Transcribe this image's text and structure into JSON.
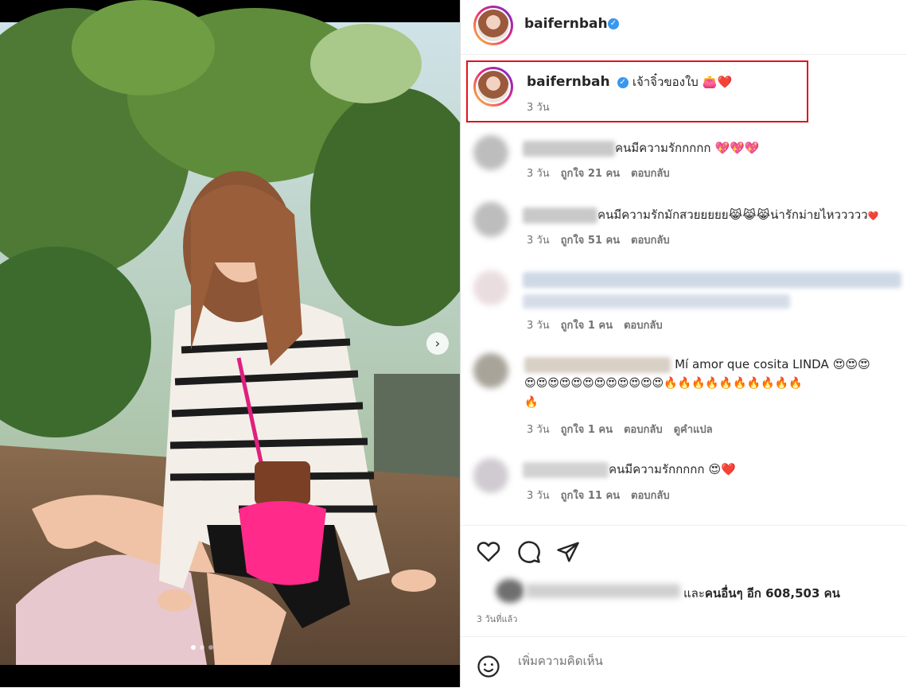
{
  "post": {
    "username": "baifernbah",
    "caption": {
      "text": "เจ้าจิ๋วของใบ",
      "emoji": "👛❤️",
      "time": "3 วัน"
    },
    "carousel": {
      "count": 3,
      "active": 1
    }
  },
  "comments": [
    {
      "text": "คนมีความรักกกกก",
      "emoji": "💖💖💖",
      "time": "3 วัน",
      "likes": "ถูกใจ 21 คน",
      "reply": "ตอบกลับ"
    },
    {
      "text": "คนมีความรักมักสวยยยยย",
      "emoji": "😹😹😹",
      "text2": "น่ารักม่ายไหววววว",
      "emoji2": "❤️",
      "time": "3 วัน",
      "likes": "ถูกใจ 51 คน",
      "reply": "ตอบกลับ"
    },
    {
      "text": "",
      "time": "3 วัน",
      "likes": "ถูกใจ 1 คน",
      "reply": "ตอบกลับ"
    },
    {
      "text": "Mí amor que cosita LINDA",
      "emoji": "😍😍😍",
      "emoji_line2": "😍😍😍😍😍😍😍😍😍😍😍😍🔥🔥🔥🔥🔥🔥🔥🔥🔥🔥",
      "emoji_line3": "🔥",
      "time": "3 วัน",
      "likes": "ถูกใจ 1 คน",
      "reply": "ตอบกลับ",
      "translate": "ดูคำแปล"
    },
    {
      "text": "คนมีความรักกกกก",
      "emoji": "😍❤️",
      "time": "3 วัน",
      "likes": "ถูกใจ 11 คน",
      "reply": "ตอบกลับ"
    }
  ],
  "likes": {
    "prefix": "และ",
    "bold": "คนอื่นๆ อีก 608,503 คน"
  },
  "time_ago": "3 วันที่แล้ว",
  "add_comment": {
    "placeholder": "เพิ่มความคิดเห็น"
  },
  "icons": {
    "like": "heart-icon",
    "comment": "comment-icon",
    "share": "share-icon",
    "emoji": "emoji-icon",
    "verified": "verified-badge-icon",
    "next": "chevron-right-icon"
  },
  "colors": {
    "highlight_box": "#e0121b",
    "verified": "#3897f0"
  }
}
